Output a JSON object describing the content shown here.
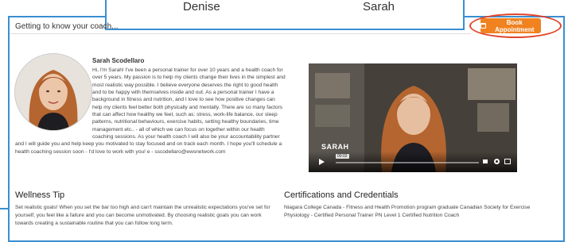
{
  "tabs": {
    "left": "Denise",
    "right": "Sarah"
  },
  "header": {
    "title": "Getting to know your coach..."
  },
  "book_button": {
    "label": "Book Appointment",
    "icon": "calendar-icon"
  },
  "coach": {
    "name": "Sarah Scodellaro",
    "bio": "Hi, I'm Sarah! I've been a personal trainer for over 10 years and a health coach for over 5 years. My passion is to help my clients change their lives in the simplest and most realistic way possible. I believe everyone deserves the right to good health and to be happy with themselves inside and out. As a personal trainer I have a background in fitness and nutrition, and I love to see how positive changes can help my clients feel better both physically and mentally. There are so many factors that can affect how healthy we feel, such as: stress, work-life balance, our sleep patterns, nutritional behaviours, exercise habits, setting healthy boundaries, time management etc.. - all of which we can focus on together within our health coaching sessions. As your health coach I will also be your accountability partner and I will guide you and help keep you motivated to stay focused and on track each month. I hope you'll schedule a health coaching session soon - I'd love to work with you! e - sscodellaro@ewsnetwork.com"
  },
  "video": {
    "overlay_label": "SARAH",
    "time": "00:02",
    "progress": 0.02
  },
  "wellness": {
    "title": "Wellness Tip",
    "text": "Set realistic goals! When you set the bar too high and can't maintain the unrealistic expectations you've set for yourself, you feel like a failure and you can become unmotivated. By choosing realistic goals you can work towards creating a sustainable routine that you can follow long term."
  },
  "certifications": {
    "title": "Certifications and Credentials",
    "text": "Niagara College Canada - Fitness and Health Promotion program graduate Canadian Society for Exercise Physiology - Certified Personal Trainer PN Level 1 Certified Nutrition Coach"
  },
  "colors": {
    "frame": "#3a8fd0",
    "button": "#f08220",
    "highlight_ring": "#e2452b"
  }
}
